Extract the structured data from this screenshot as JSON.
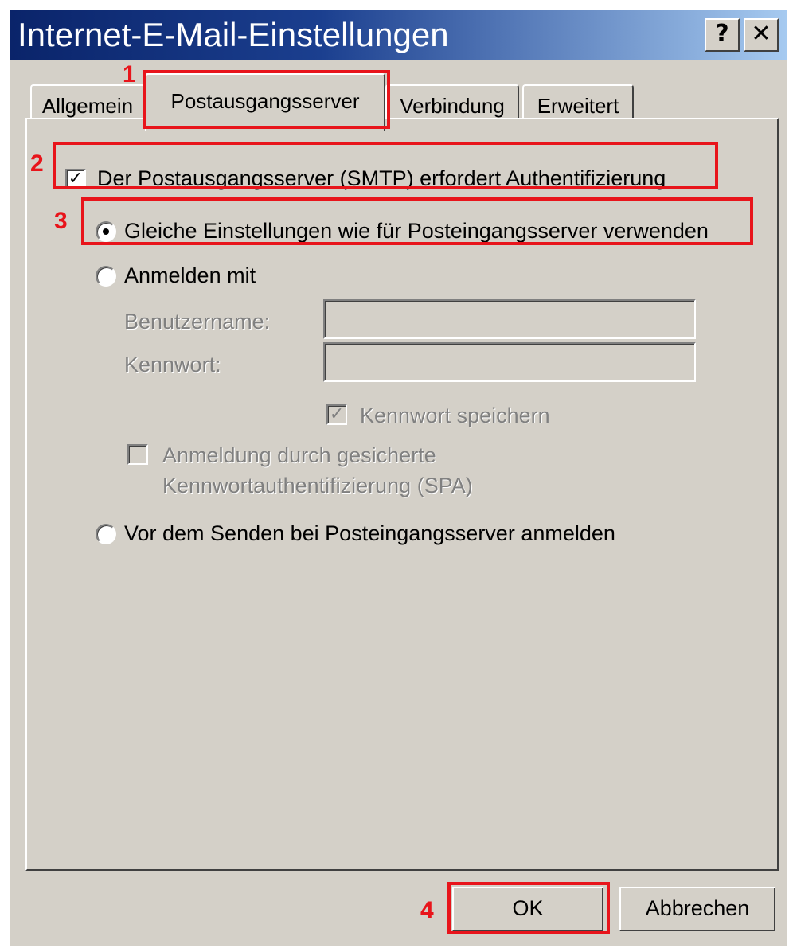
{
  "dialog": {
    "title": "Internet-E-Mail-Einstellungen",
    "help_button": "?",
    "close_button": "✕"
  },
  "tabs": [
    {
      "label": "Allgemein",
      "selected": false
    },
    {
      "label": "Postausgangsserver",
      "selected": true
    },
    {
      "label": "Verbindung",
      "selected": false
    },
    {
      "label": "Erweitert",
      "selected": false
    }
  ],
  "smtp_auth": {
    "checkbox_label": "Der Postausgangsserver (SMTP) erfordert Authentifizierung",
    "checked": true
  },
  "auth_options": {
    "same_settings_label": "Gleiche Einstellungen wie für Posteingangsserver verwenden",
    "login_with_label": "Anmelden mit",
    "username_label": "Benutzername:",
    "username_value": "",
    "password_label": "Kennwort:",
    "password_value": "",
    "save_password_label": "Kennwort speichern",
    "save_password_checked": true,
    "spa_label_line1": "Anmeldung durch gesicherte",
    "spa_label_line2": "Kennwortauthentifizierung (SPA)",
    "spa_checked": false,
    "pop_before_smtp_label": "Vor dem Senden bei Posteingangsserver anmelden",
    "selected_option": "same_settings"
  },
  "buttons": {
    "ok": "OK",
    "cancel": "Abbrechen"
  },
  "annotations": {
    "step1": "1",
    "step2": "2",
    "step3": "3",
    "step4": "4",
    "color": "#e8141b"
  },
  "colors": {
    "dialog_bg": "#d4d0c8",
    "titlebar": "#0a246a",
    "disabled_text": "#808080"
  }
}
